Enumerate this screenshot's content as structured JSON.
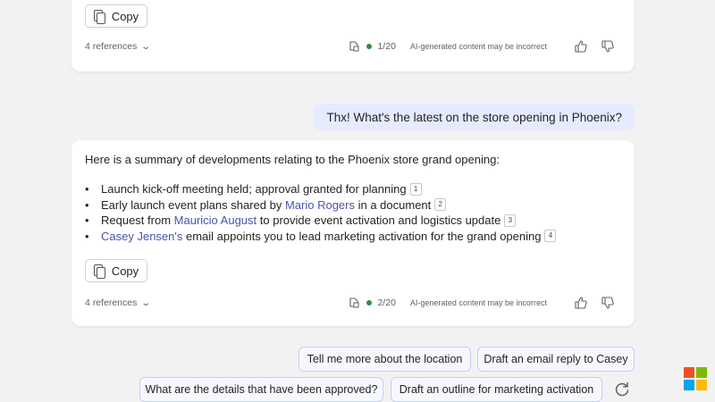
{
  "colors": {
    "background": "#f2f2f3",
    "card": "#ffffff",
    "user_bubble": "#e6ebff",
    "mention": "#4f52b2",
    "status_dot": "#2e8b45",
    "chip_border": "#c7cdf5"
  },
  "previous_response": {
    "copy_label": "Copy",
    "references_label": "4 references",
    "response_count": "1/20",
    "disclaimer": "AI-generated content may be incorrect"
  },
  "user_message": "Thx! What's the latest on the store opening in Phoenix?",
  "response": {
    "intro": "Here is a summary of developments relating to the Phoenix store grand opening:",
    "points": [
      {
        "before": "Launch kick-off meeting held; approval granted for planning",
        "mention": "",
        "after": "",
        "cite": "1"
      },
      {
        "before": "Early launch event plans shared by ",
        "mention": "Mario Rogers",
        "after": " in a document",
        "cite": "2"
      },
      {
        "before": "Request from ",
        "mention": "Mauricio August",
        "after": " to provide event activation and logistics update",
        "cite": "3"
      },
      {
        "before": "",
        "mention": "Casey Jensen's",
        "after": " email appoints you to lead marketing activation for the grand opening",
        "cite": "4"
      }
    ],
    "copy_label": "Copy",
    "references_label": "4 references",
    "response_count": "2/20",
    "disclaimer": "AI-generated content may be incorrect"
  },
  "suggestions": [
    "Tell me more about the location",
    "Draft an email reply to Casey",
    "What are the details that have been approved?",
    "Draft an outline for marketing activation"
  ],
  "icons": {
    "copy": "copy-icon",
    "chevron": "chevron-down-icon",
    "sensitivity": "sensitivity-label-icon",
    "like": "thumbs-up-icon",
    "dislike": "thumbs-down-icon",
    "refresh": "refresh-icon",
    "logo": "microsoft-logo-icon"
  },
  "logo_colors": [
    "#f25022",
    "#7fba00",
    "#00a4ef",
    "#ffb900"
  ]
}
